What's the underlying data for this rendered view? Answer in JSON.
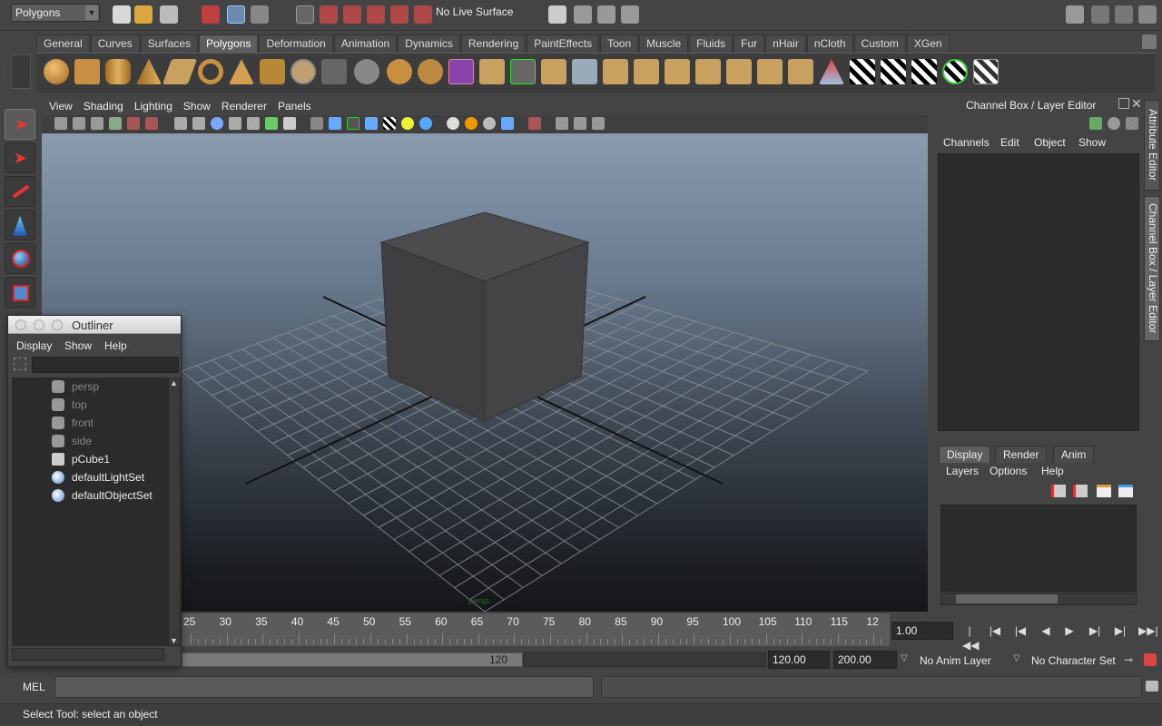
{
  "status_line": {
    "mode": "Polygons",
    "live_surface": "No Live Surface"
  },
  "shelf": {
    "tabs": [
      "General",
      "Curves",
      "Surfaces",
      "Polygons",
      "Deformation",
      "Animation",
      "Dynamics",
      "Rendering",
      "PaintEffects",
      "Toon",
      "Muscle",
      "Fluids",
      "Fur",
      "nHair",
      "nCloth",
      "Custom",
      "XGen"
    ],
    "active_tab": "Polygons"
  },
  "panel": {
    "menus": [
      "View",
      "Shading",
      "Lighting",
      "Show",
      "Renderer",
      "Panels"
    ]
  },
  "timeline": {
    "ticks": [
      "25",
      "30",
      "35",
      "40",
      "45",
      "50",
      "55",
      "60",
      "65",
      "70",
      "75",
      "80",
      "85",
      "90",
      "95",
      "100",
      "105",
      "110",
      "115",
      "12"
    ],
    "current_frame": "1.00",
    "range_end_label": "120",
    "end_time": "120.00",
    "total_end": "200.00",
    "anim_layer": "No Anim Layer",
    "character_set": "No Character Set"
  },
  "command_line": {
    "label": "MEL"
  },
  "help_line": {
    "text": "Select Tool: select an object"
  },
  "channel_box": {
    "title": "Channel Box / Layer Editor",
    "menus": [
      "Channels",
      "Edit",
      "Object",
      "Show"
    ],
    "side_tabs": [
      "Attribute Editor",
      "Channel Box / Layer Editor"
    ]
  },
  "layer_editor": {
    "tabs": [
      "Display",
      "Render",
      "Anim"
    ],
    "active_tab": "Display",
    "menus": [
      "Layers",
      "Options",
      "Help"
    ]
  },
  "outliner": {
    "title": "Outliner",
    "menus": [
      "Display",
      "Show",
      "Help"
    ],
    "items": [
      {
        "label": "persp",
        "icon": "camera-icon",
        "dim": true
      },
      {
        "label": "top",
        "icon": "camera-icon",
        "dim": true
      },
      {
        "label": "front",
        "icon": "camera-icon",
        "dim": true
      },
      {
        "label": "side",
        "icon": "camera-icon",
        "dim": true
      },
      {
        "label": "pCube1",
        "icon": "mesh-icon",
        "dim": false
      },
      {
        "label": "defaultLightSet",
        "icon": "set-icon",
        "dim": false
      },
      {
        "label": "defaultObjectSet",
        "icon": "set-icon",
        "dim": false
      }
    ]
  },
  "viewport": {
    "camera_label": "persp"
  }
}
